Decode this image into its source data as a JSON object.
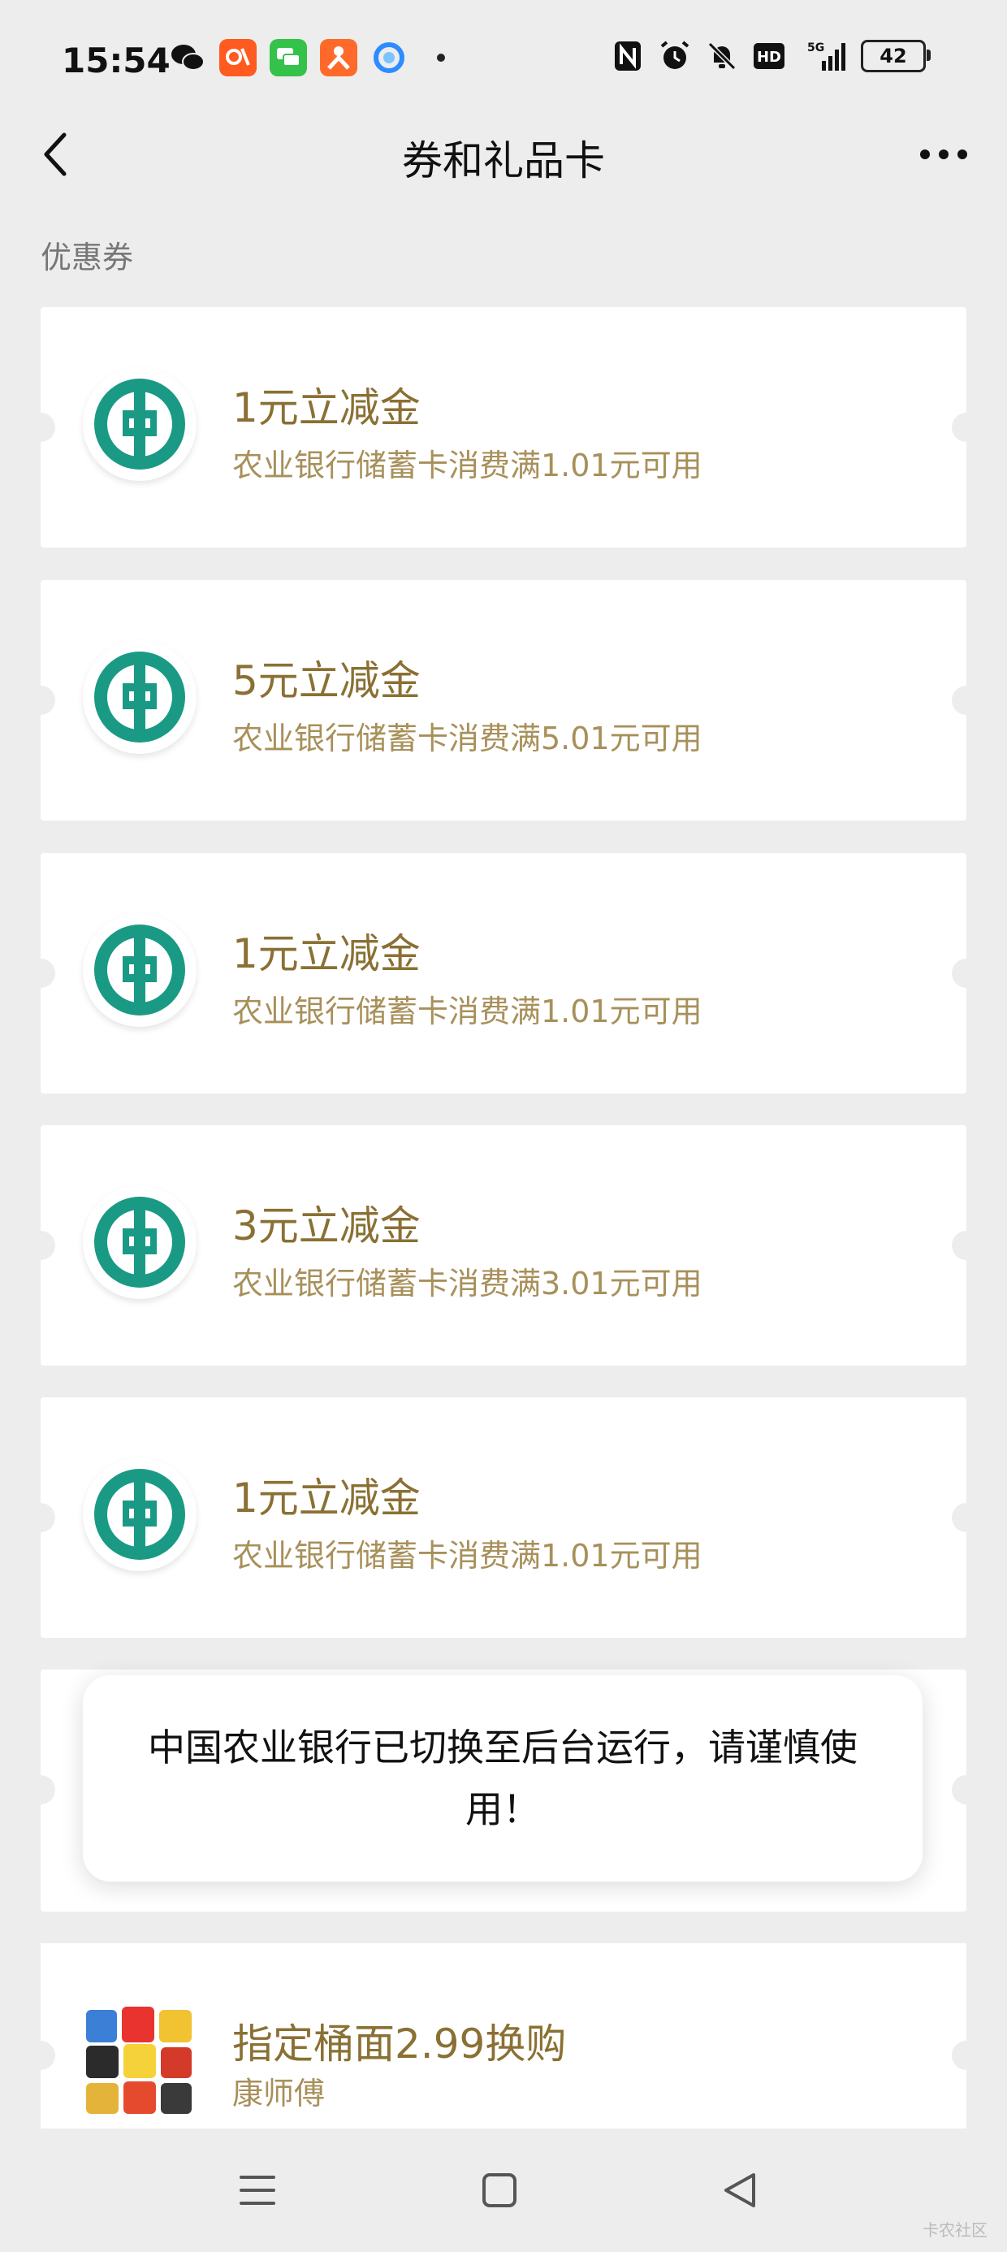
{
  "status_bar": {
    "time": "15:54",
    "battery": "42",
    "app_icons": [
      "wechat-icon",
      "taobao-icon",
      "message-icon",
      "ant-app-icon",
      "browser-icon"
    ],
    "system_icons": [
      "nfc-icon",
      "alarm-icon",
      "mute-icon",
      "hd-icon",
      "signal-5g-icon"
    ],
    "hd_label": "HD",
    "network_label": "5G"
  },
  "header": {
    "title": "券和礼品卡"
  },
  "section": {
    "label": "优惠券"
  },
  "coupons": [
    {
      "title": "1元立减金",
      "subtitle": "农业银行储蓄卡消费满1.01元可用"
    },
    {
      "title": "5元立减金",
      "subtitle": "农业银行储蓄卡消费满5.01元可用"
    },
    {
      "title": "1元立减金",
      "subtitle": "农业银行储蓄卡消费满1.01元可用"
    },
    {
      "title": "3元立减金",
      "subtitle": "农业银行储蓄卡消费满3.01元可用"
    },
    {
      "title": "1元立减金",
      "subtitle": "农业银行储蓄卡消费满1.01元可用"
    }
  ],
  "toast": {
    "message": "中国农业银行已切换至后台运行，请谨慎使用！"
  },
  "last_coupon": {
    "title": "指定桶面2.99换购",
    "subtitle": "康师傅"
  },
  "watermark": "卡农社区",
  "colors": {
    "accent_gold": "#8a7033",
    "abc_green": "#1a9a85"
  }
}
